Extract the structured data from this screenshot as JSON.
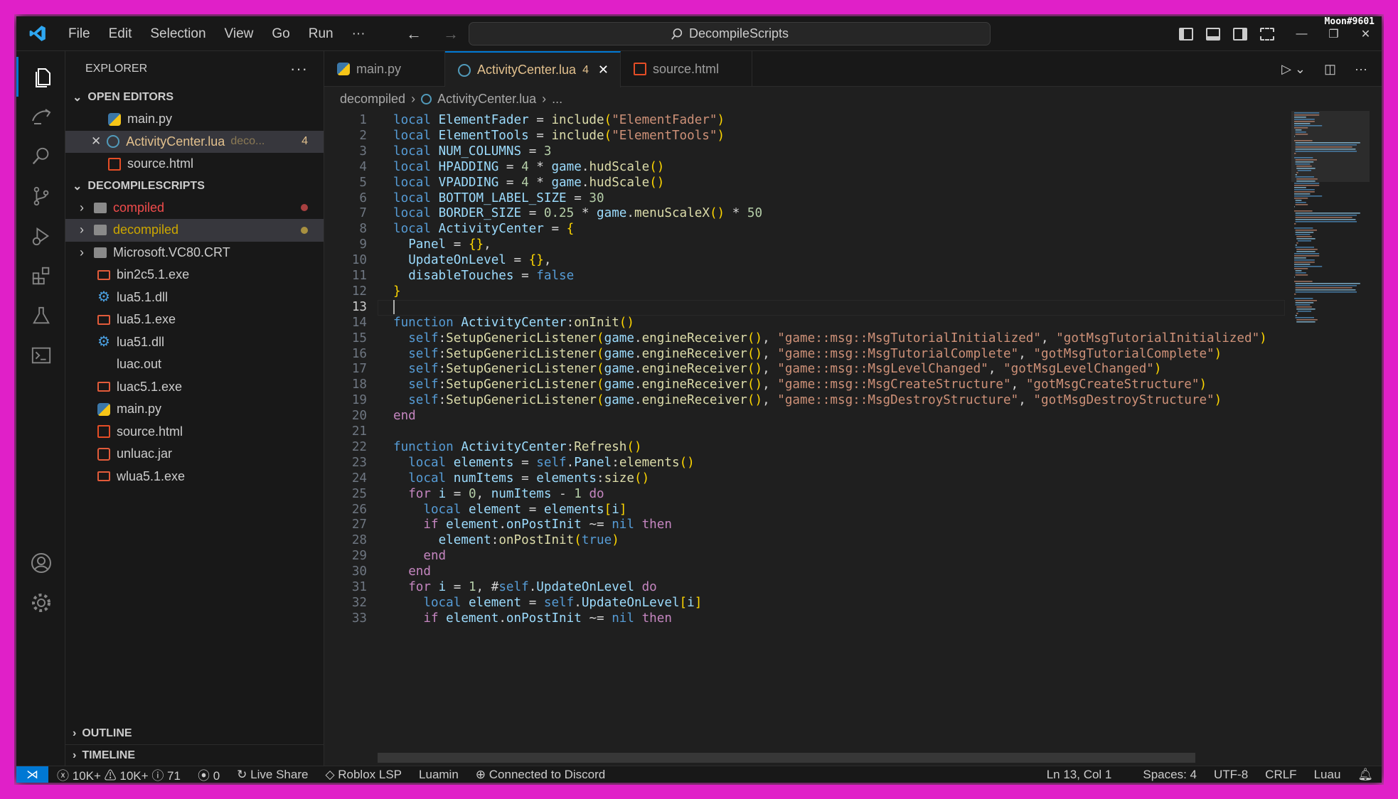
{
  "titlebar": {
    "menu": [
      "File",
      "Edit",
      "Selection",
      "View",
      "Go",
      "Run",
      "···"
    ],
    "search": "DecompileScripts",
    "badge": "Moon#9601"
  },
  "sidebar": {
    "title": "EXPLORER",
    "open_editors_label": "OPEN EDITORS",
    "open_editors": [
      {
        "name": "main.py",
        "icon": "python-icon"
      },
      {
        "name": "ActivityCenter.lua",
        "icon": "lua-icon",
        "desc": "deco...",
        "count": "4"
      },
      {
        "name": "source.html",
        "icon": "html-icon"
      }
    ],
    "project_label": "DECOMPILESCRIPTS",
    "folders": [
      {
        "name": "compiled",
        "color": "#f14c4c"
      },
      {
        "name": "decompiled",
        "color": "#cca700"
      },
      {
        "name": "Microsoft.VC80.CRT",
        "color": "#cccccc"
      }
    ],
    "files": [
      "bin2c5.1.exe",
      "lua5.1.dll",
      "lua5.1.exe",
      "lua51.dll",
      "luac.out",
      "luac5.1.exe",
      "main.py",
      "source.html",
      "unluac.jar",
      "wlua5.1.exe"
    ],
    "outline_label": "OUTLINE",
    "timeline_label": "TIMELINE"
  },
  "tabs": [
    {
      "label": "main.py",
      "icon": "python-icon"
    },
    {
      "label": "ActivityCenter.lua",
      "icon": "lua-icon",
      "count": "4"
    },
    {
      "label": "source.html",
      "icon": "html-icon"
    }
  ],
  "breadcrumb": [
    "decompiled",
    "ActivityCenter.lua",
    "..."
  ],
  "code": {
    "line_numbers": [
      "1",
      "2",
      "3",
      "4",
      "5",
      "6",
      "7",
      "8",
      "9",
      "10",
      "11",
      "12",
      "13",
      "14",
      "15",
      "16",
      "17",
      "18",
      "19",
      "20",
      "21",
      "22",
      "23",
      "24",
      "25",
      "26",
      "27",
      "28",
      "29",
      "30",
      "31",
      "32",
      "33"
    ],
    "current_line": "13",
    "lines": [
      "local ElementFader = include(\"ElementFader\")",
      "local ElementTools = include(\"ElementTools\")",
      "local NUM_COLUMNS = 3",
      "local HPADDING = 4 * game.hudScale()",
      "local VPADDING = 4 * game.hudScale()",
      "local BOTTOM_LABEL_SIZE = 30",
      "local BORDER_SIZE = 0.25 * game.menuScaleX() * 50",
      "local ActivityCenter = {",
      "  Panel = {},",
      "  UpdateOnLevel = {},",
      "  disableTouches = false",
      "}",
      "",
      "function ActivityCenter:onInit()",
      "  self:SetupGenericListener(game.engineReceiver(), \"game::msg::MsgTutorialInitialized\", \"gotMsgTutorialInitialized\")",
      "  self:SetupGenericListener(game.engineReceiver(), \"game::msg::MsgTutorialComplete\", \"gotMsgTutorialComplete\")",
      "  self:SetupGenericListener(game.engineReceiver(), \"game::msg::MsgLevelChanged\", \"gotMsgLevelChanged\")",
      "  self:SetupGenericListener(game.engineReceiver(), \"game::msg::MsgCreateStructure\", \"gotMsgCreateStructure\")",
      "  self:SetupGenericListener(game.engineReceiver(), \"game::msg::MsgDestroyStructure\", \"gotMsgDestroyStructure\")",
      "end",
      "",
      "function ActivityCenter:Refresh()",
      "  local elements = self.Panel:elements()",
      "  local numItems = elements:size()",
      "  for i = 0, numItems - 1 do",
      "    local element = elements[i]",
      "    if element.onPostInit ~= nil then",
      "      element:onPostInit(true)",
      "    end",
      "  end",
      "  for i = 1, #self.UpdateOnLevel do",
      "    local element = self.UpdateOnLevel[i]",
      "    if element.onPostInit ~= nil then"
    ]
  },
  "status": {
    "errors": "10K+",
    "warnings": "10K+",
    "info": "71",
    "ports": "0",
    "live_share": "Live Share",
    "lsp": "Roblox LSP",
    "luamin": "Luamin",
    "discord": "Connected to Discord",
    "position": "Ln 13, Col 1",
    "spaces": "Spaces: 4",
    "encoding": "UTF-8",
    "eol": "CRLF",
    "language": "Luau"
  },
  "colors": {
    "accent": "#0078d4",
    "frame": "#e020c8",
    "modified": "#e2c08d"
  }
}
